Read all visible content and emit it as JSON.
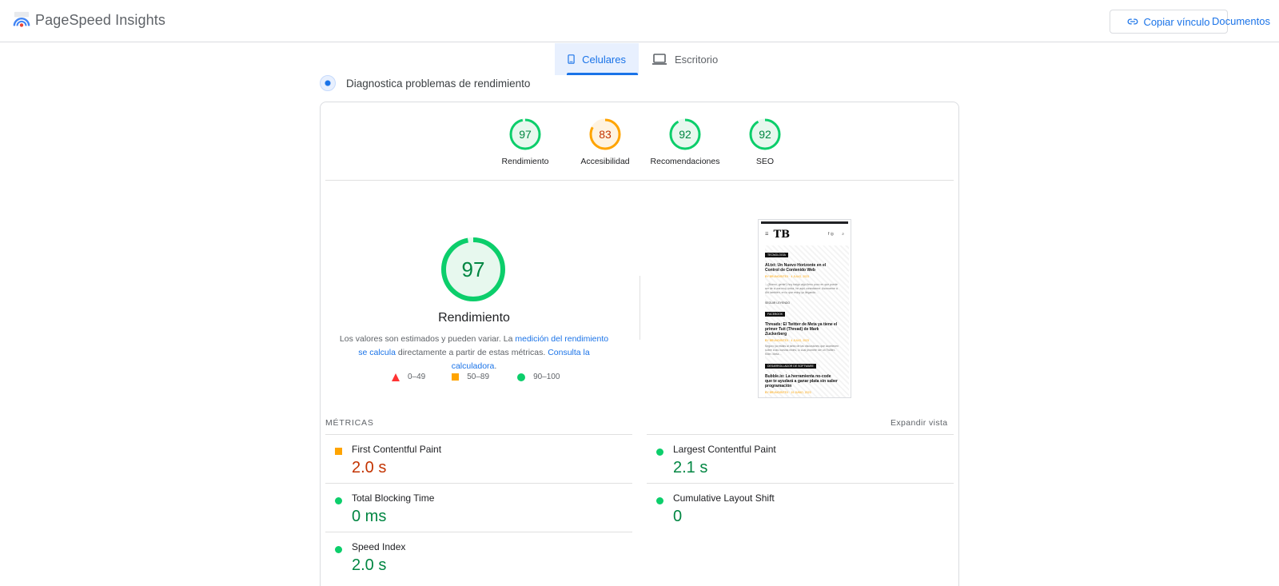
{
  "header": {
    "app_title": "PageSpeed Insights",
    "copy_link_label": "Copiar vínculo",
    "docs_label": "Documentos"
  },
  "tabs": [
    {
      "label": "Celulares",
      "active": true,
      "icon": "smartphone-icon"
    },
    {
      "label": "Escritorio",
      "active": false,
      "icon": "laptop-icon"
    }
  ],
  "diagnose": {
    "title": "Diagnostica problemas de rendimiento"
  },
  "categories": [
    {
      "label": "Rendimiento",
      "score": 97,
      "color": "#0cce6b",
      "text_color": "#018642"
    },
    {
      "label": "Accesibilidad",
      "score": 83,
      "color": "#ffa400",
      "text_color": "#c33300"
    },
    {
      "label": "Recomendaciones",
      "score": 92,
      "color": "#0cce6b",
      "text_color": "#018642"
    },
    {
      "label": "SEO",
      "score": 92,
      "color": "#0cce6b",
      "text_color": "#018642"
    }
  ],
  "performance": {
    "score": 97,
    "title": "Rendimiento",
    "desc_prefix": "Los valores son estimados y pueden variar. La ",
    "desc_link1": "medición del rendimiento se calcula",
    "desc_middle": " directamente a partir de estas métricas. ",
    "desc_link2": "Consulta la calculadora",
    "desc_suffix": ".",
    "legend": [
      {
        "range": "0–49",
        "shape": "triangle",
        "color": "#ff3333"
      },
      {
        "range": "50–89",
        "shape": "square",
        "color": "#ffa400"
      },
      {
        "range": "90–100",
        "shape": "circle",
        "color": "#0cce6b"
      }
    ]
  },
  "thumbnail": {
    "logo": "TB",
    "posts": [
      {
        "tag": "TECNOLOGÍA",
        "title": "AI.txt: Un Nuevo Horizonte en el Control de Contenido Web",
        "meta": "BY BRUNO/BITEX · 4 JULIO, 2023",
        "text": "…(Bueno, gente!) hoy traigo algo lleno poco en que puede ser de a una muy única, he aquí conectarme. Asomarme a Ahí también, en lo que estoy yo llegando…",
        "read": "SEGUIR LEYENDO"
      },
      {
        "tag": "FACEBOOK",
        "title": "Threads: El Twitter de Meta ya tiene el primer Tuit (Thread) de Mark Zuckerberg",
        "meta": "BY BRUNO/BITEX · 4 JULIO, 2023",
        "text": "Seguro ya estáis al tanto de las discusiones que acontecen sobre a las nuevas redes, lo cual promete ser un Twitter-Killer. Meta…"
      },
      {
        "tag": "DESARROLLADOR DE SOFTWARE",
        "title": "Bubble.io: La herramienta no-code que te ayudará a ganar plata sin saber programación",
        "meta": "BY BRUNO/BITEX · 19 JUNIO, 2023"
      }
    ]
  },
  "metrics": {
    "section_label": "MÉTRICAS",
    "expand_label": "Expandir vista",
    "items": [
      {
        "name": "First Contentful Paint",
        "value": "2.0 s",
        "status": "average"
      },
      {
        "name": "Largest Contentful Paint",
        "value": "2.1 s",
        "status": "good"
      },
      {
        "name": "Total Blocking Time",
        "value": "0 ms",
        "status": "good"
      },
      {
        "name": "Cumulative Layout Shift",
        "value": "0",
        "status": "good"
      },
      {
        "name": "Speed Index",
        "value": "2.0 s",
        "status": "good"
      }
    ]
  }
}
